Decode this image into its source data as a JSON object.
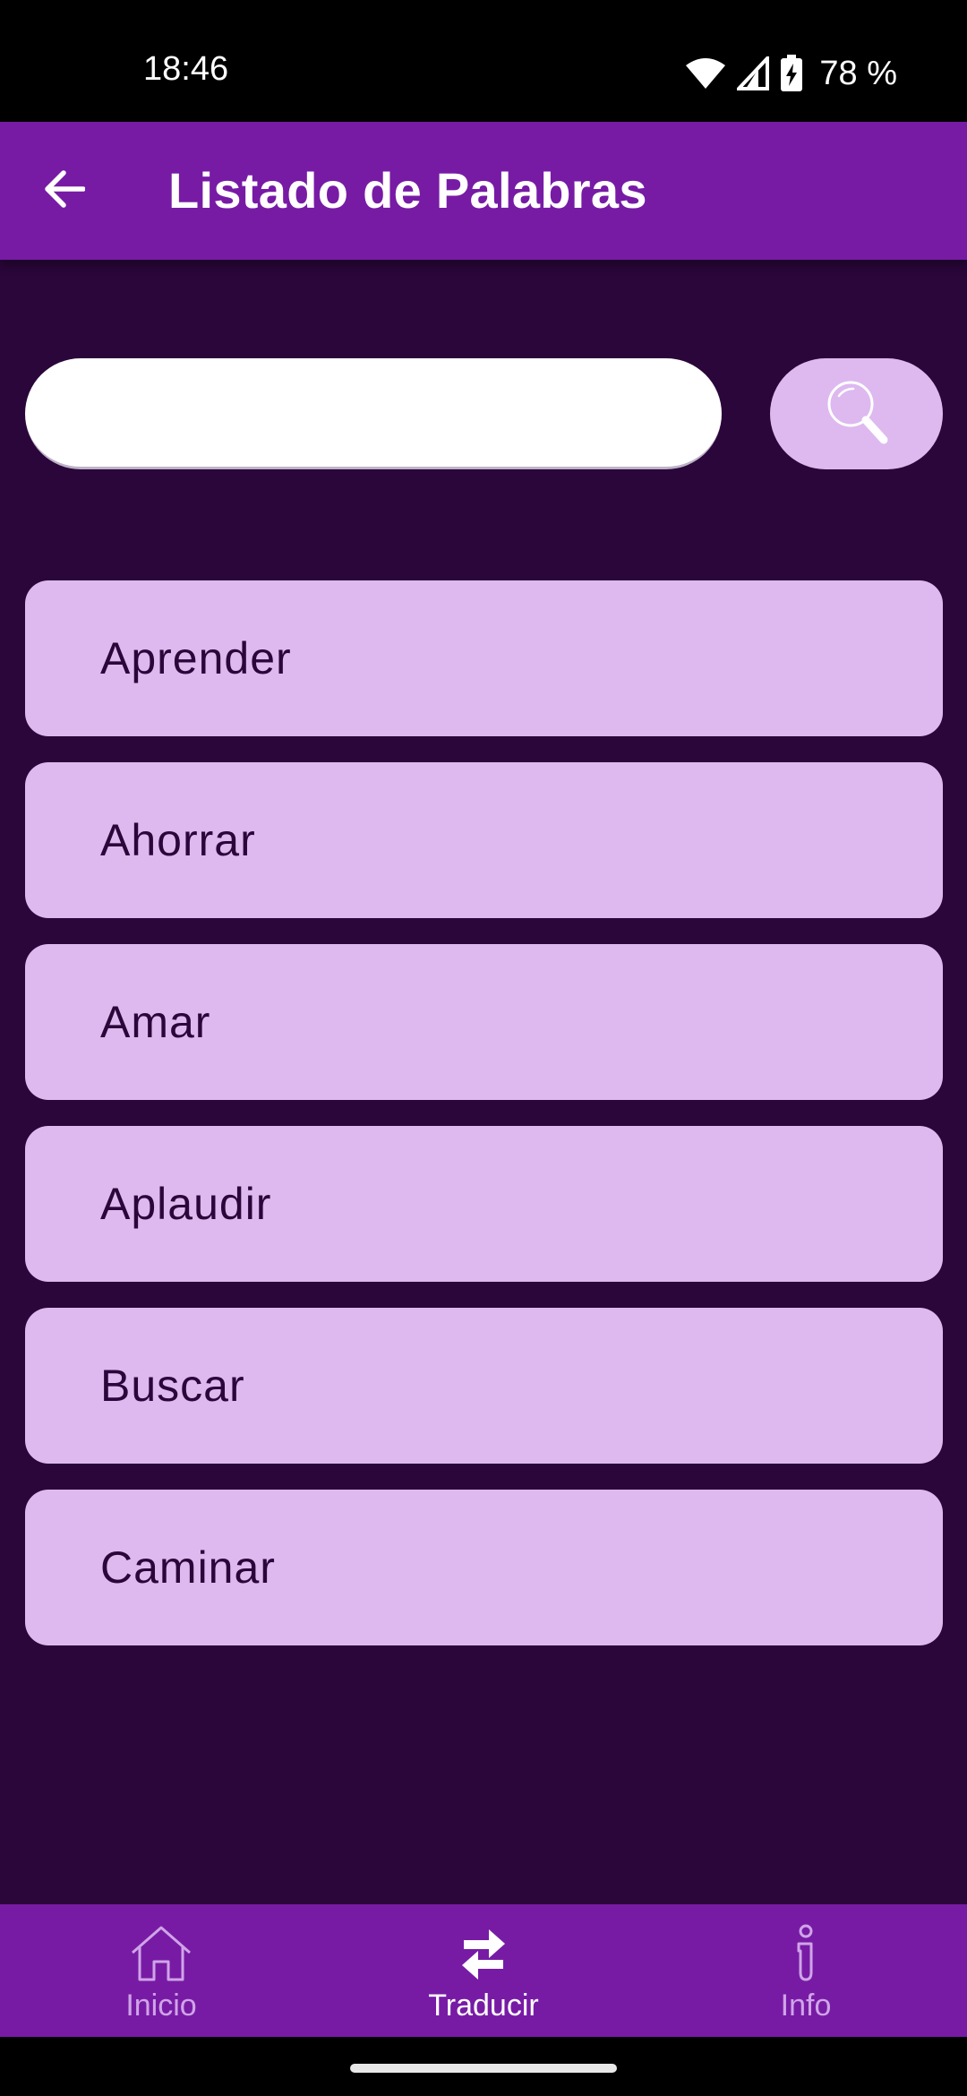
{
  "status_bar": {
    "time": "18:46",
    "battery": "78 %",
    "icons": [
      "wifi-icon",
      "signal-icon",
      "battery-charging-icon"
    ]
  },
  "app_bar": {
    "title": "Listado de Palabras",
    "back_icon": "arrow-left-icon"
  },
  "search": {
    "value": "",
    "placeholder": "",
    "button_icon": "magnifier-icon"
  },
  "words": [
    "Aprender",
    "Ahorrar",
    "Amar",
    "Aplaudir",
    "Buscar",
    "Caminar"
  ],
  "bottom_nav": {
    "items": [
      {
        "label": "Inicio",
        "icon": "home-icon",
        "active": false
      },
      {
        "label": "Traducir",
        "icon": "swap-arrows-icon",
        "active": true
      },
      {
        "label": "Info",
        "icon": "info-icon",
        "active": false
      }
    ]
  },
  "colors": {
    "background": "#2a063a",
    "primary": "#771ba5",
    "card": "#ddb9ef",
    "inactive_nav": "#d0a4e8"
  }
}
